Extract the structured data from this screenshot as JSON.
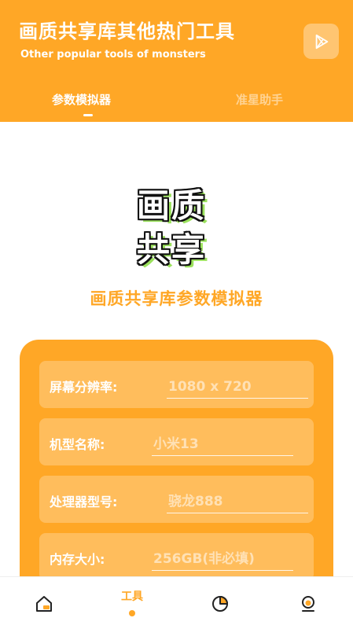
{
  "header": {
    "title": "画质共享库其他热门工具",
    "subtitle": "Other popular tools of monsters",
    "play_icon": "play-store-icon"
  },
  "tabs": [
    {
      "label": "参数模拟器",
      "active": true
    },
    {
      "label": "准星助手",
      "active": false
    }
  ],
  "logo": {
    "line1": "画质",
    "line2": "共享"
  },
  "main": {
    "heading": "画质共享库参数模拟器"
  },
  "form": {
    "fields": [
      {
        "label": "屏幕分辨率:",
        "value": "",
        "placeholder": "1080 x 720"
      },
      {
        "label": "机型名称:",
        "value": "",
        "placeholder": "小米13"
      },
      {
        "label": "处理器型号:",
        "value": "",
        "placeholder": "骁龙888"
      },
      {
        "label": "内存大小:",
        "value": "",
        "placeholder": "256GB(非必填)"
      }
    ]
  },
  "bottom_nav": {
    "items": [
      {
        "icon": "home-icon",
        "label": ""
      },
      {
        "icon": "tools-icon",
        "label": "工具",
        "active": true
      },
      {
        "icon": "pie-chart-icon",
        "label": ""
      },
      {
        "icon": "profile-icon",
        "label": ""
      }
    ]
  },
  "colors": {
    "accent": "#FFA726",
    "white": "#FFFFFF",
    "logo_shadow": "#9BE15D"
  }
}
